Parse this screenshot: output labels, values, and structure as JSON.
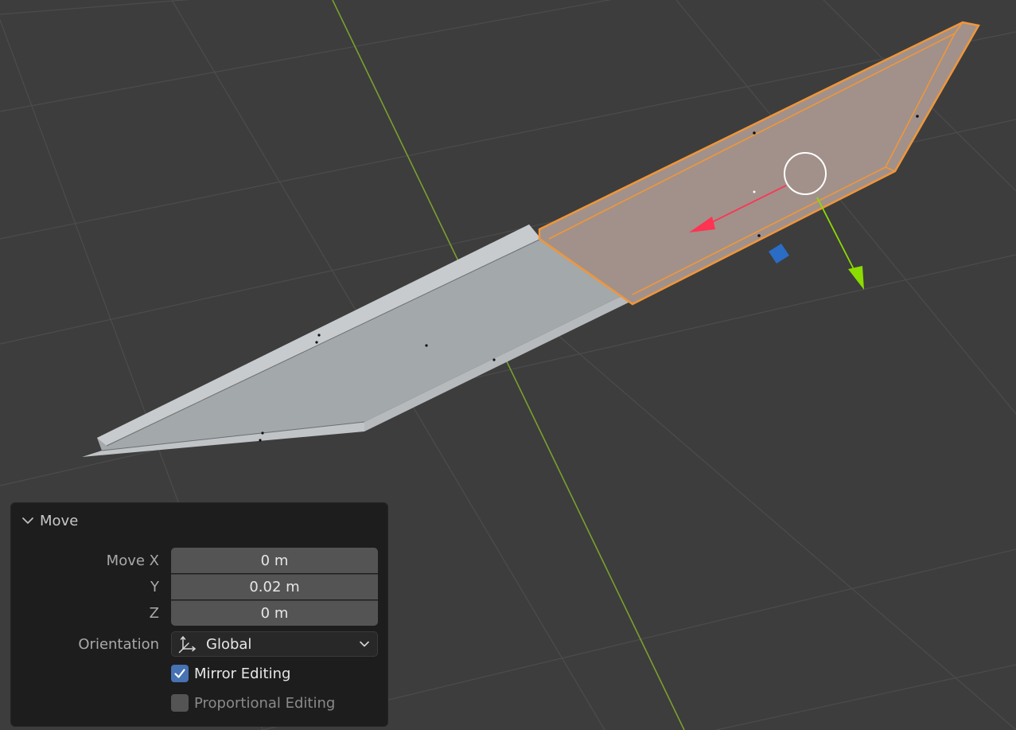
{
  "viewport": {
    "grid_color": "#4c4c4c",
    "y_axis_color": "#7aa02e",
    "selection_color": "#f0963a",
    "gizmo": {
      "x_arrow_color": "#ff3352",
      "y_arrow_color": "#8bdc00",
      "z_handle_color": "#2b6cc4",
      "center_ring": "white-circle"
    }
  },
  "operator_panel": {
    "title": "Move",
    "collapse_icon": "chevron-down-icon",
    "fields": [
      {
        "label": "Move X",
        "value": "0 m"
      },
      {
        "label": "Y",
        "value": "0.02 m"
      },
      {
        "label": "Z",
        "value": "0 m"
      }
    ],
    "orientation": {
      "label": "Orientation",
      "value": "Global",
      "icon": "orientation-global-icon"
    },
    "mirror_editing": {
      "label": "Mirror Editing",
      "checked": true
    },
    "proportional_editing": {
      "label": "Proportional Editing",
      "checked": false
    },
    "accent_color": "#4772b3"
  }
}
